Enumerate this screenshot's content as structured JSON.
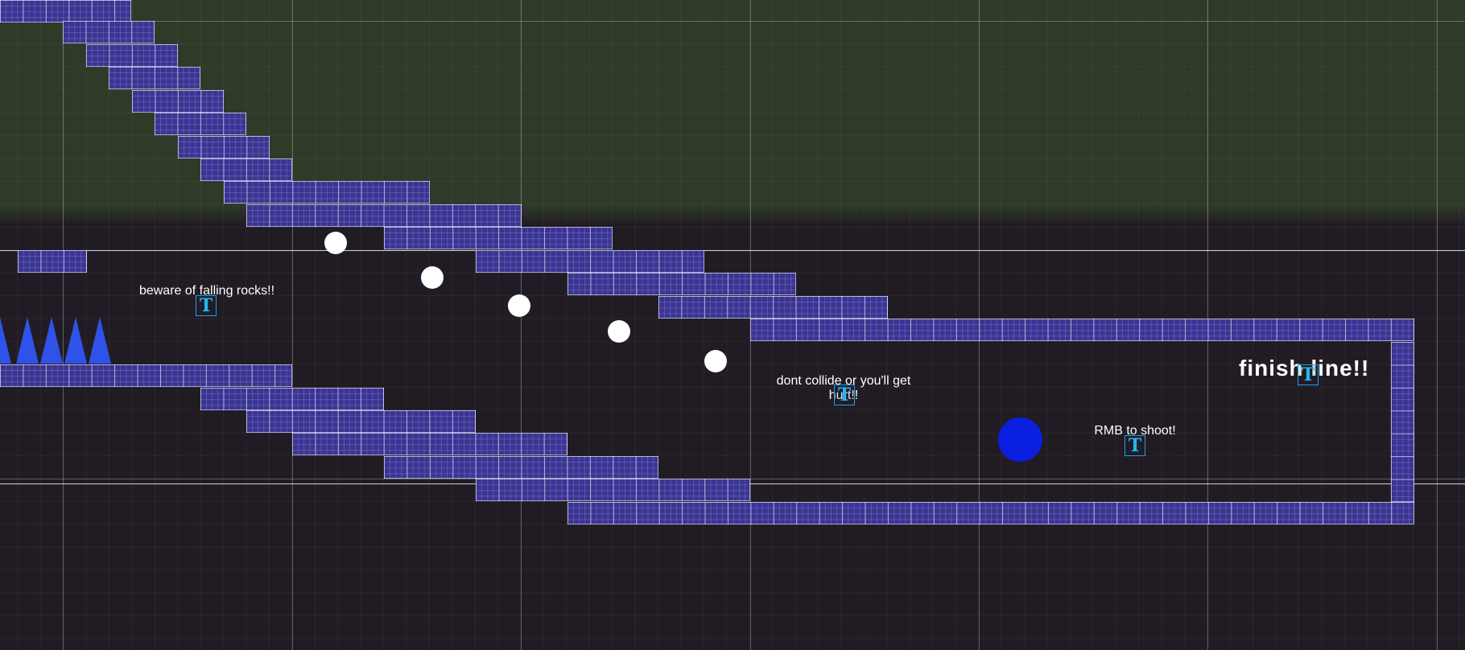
{
  "scene": {
    "colors": {
      "background": "#211b24",
      "sky": "#2e3b29",
      "tile": "#3a3594",
      "player": "#0b1fe0",
      "spike": "#2f52e8",
      "rock": "#ffffff",
      "text_marker": "#28b4f0"
    }
  },
  "hints": {
    "falling_rocks": "beware of falling rocks!!",
    "collide": "dont collide or you'll get hurt!!",
    "shoot": "RMB to shoot!",
    "finish": "finish line!!"
  },
  "markers": {
    "text_marker_glyph": "T",
    "icon": "text-trigger-icon"
  },
  "entities": {
    "player": "player-ball",
    "rocks_count": 5,
    "spikes_count": 5
  }
}
